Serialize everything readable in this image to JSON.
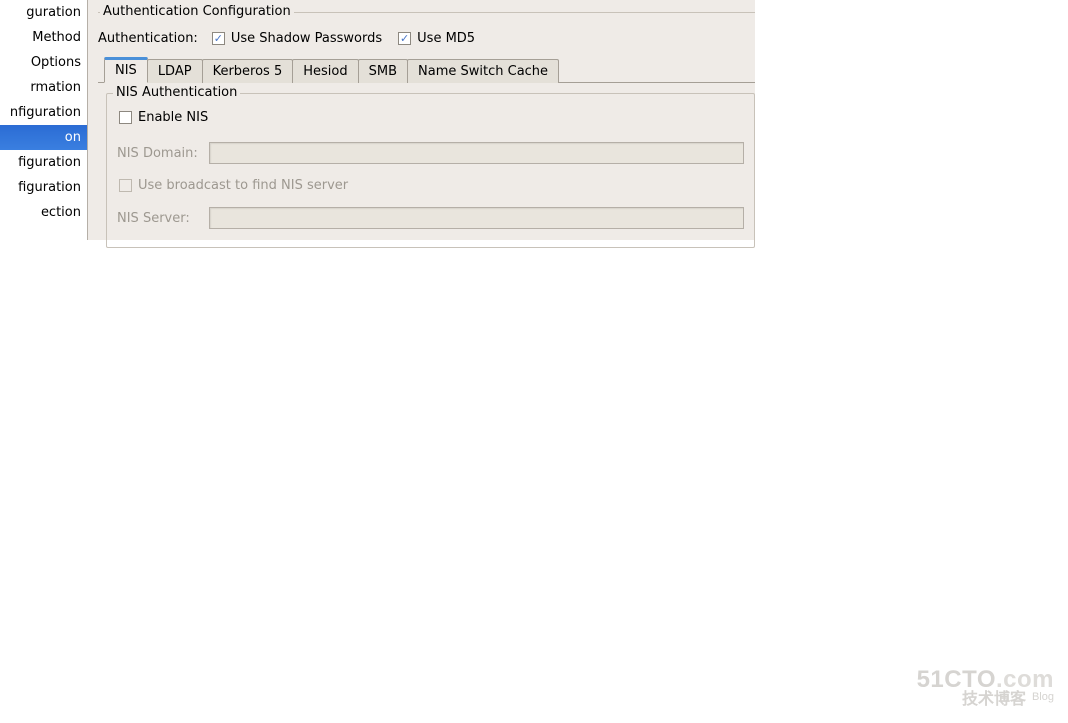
{
  "sidebar": {
    "items": [
      {
        "label": "guration"
      },
      {
        "label": "Method"
      },
      {
        "label": " Options"
      },
      {
        "label": "rmation"
      },
      {
        "label": "nfiguration"
      },
      {
        "label": "on",
        "selected": true
      },
      {
        "label": "figuration"
      },
      {
        "label": "figuration"
      },
      {
        "label": "ection"
      }
    ]
  },
  "panel": {
    "title": "Authentication Configuration",
    "auth_label": "Authentication:",
    "use_shadow": "Use Shadow Passwords",
    "use_md5": "Use MD5",
    "tabs": [
      "NIS",
      "LDAP",
      "Kerberos 5",
      "Hesiod",
      "SMB",
      "Name Switch Cache"
    ],
    "active_tab": 0,
    "nis": {
      "title": "NIS Authentication",
      "enable": "Enable NIS",
      "domain_label": "NIS Domain:",
      "domain_value": "",
      "broadcast": "Use broadcast to find NIS server",
      "server_label": "NIS Server:",
      "server_value": ""
    }
  },
  "watermark": {
    "line1a": "51CTO",
    "line1b": ".com",
    "line2": "技术博客",
    "blog": "Blog"
  }
}
